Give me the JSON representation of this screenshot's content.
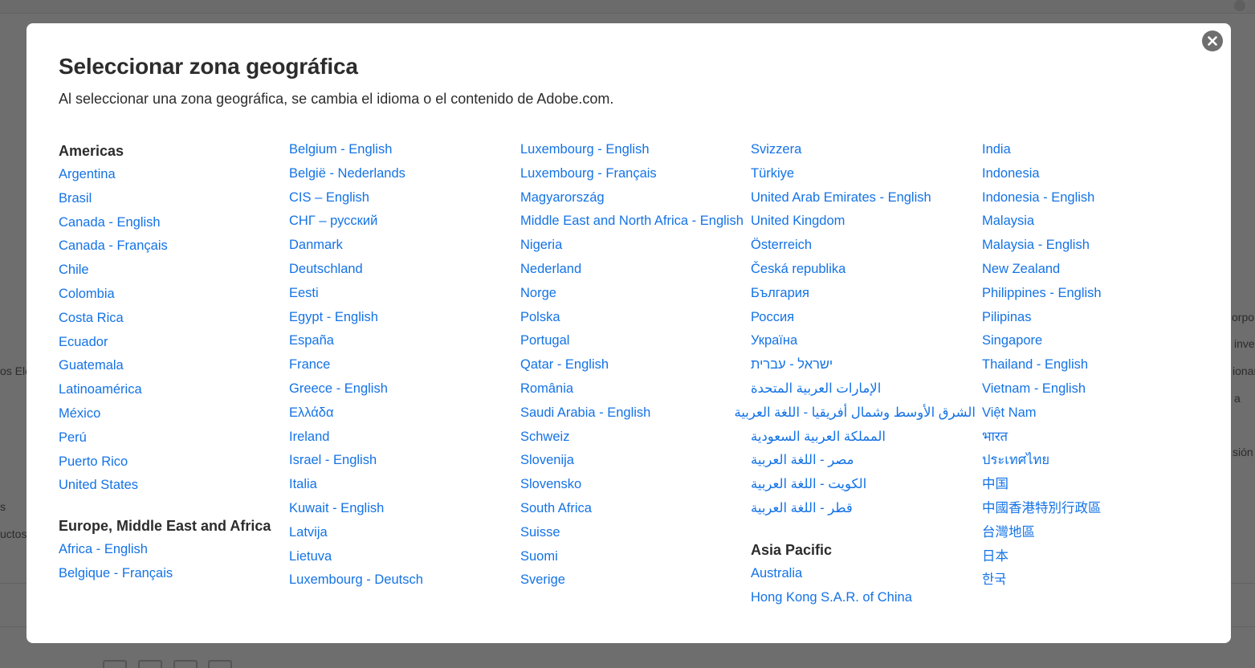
{
  "modal": {
    "title": "Seleccionar zona geográfica",
    "subtitle": "Al seleccionar una zona geográfica, se cambia el idioma o el contenido de Adobe.com.",
    "close_icon": "close-icon"
  },
  "background": {
    "fragments": [
      "os Ele",
      "s",
      "uctos",
      "orpo",
      "inve",
      "ionar",
      "a",
      "sión"
    ]
  },
  "regions": {
    "americas": {
      "heading": "Americas",
      "items": [
        "Argentina",
        "Brasil",
        "Canada - English",
        "Canada - Français",
        "Chile",
        "Colombia",
        "Costa Rica",
        "Ecuador",
        "Guatemala",
        "Latinoamérica",
        "México",
        "Perú",
        "Puerto Rico",
        "United States"
      ]
    },
    "emea": {
      "heading": "Europe, Middle East and Africa",
      "col1": [
        "Africa - English",
        "Belgique - Français"
      ],
      "col2": [
        "Belgium - English",
        "België - Nederlands",
        "CIS – English",
        "СНГ – русский",
        "Danmark",
        "Deutschland",
        "Eesti",
        "Egypt - English",
        "España",
        "France",
        "Greece - English",
        "Ελλάδα",
        "Ireland",
        "Israel - English",
        "Italia",
        "Kuwait - English",
        "Latvija",
        "Lietuva",
        "Luxembourg - Deutsch"
      ],
      "col3": [
        "Luxembourg - English",
        "Luxembourg - Français",
        "Magyarország",
        "Middle East and North Africa - English",
        "Nigeria",
        "Nederland",
        "Norge",
        "Polska",
        "Portugal",
        "Qatar - English",
        "România",
        "Saudi Arabia - English",
        "Schweiz",
        "Slovenija",
        "Slovensko",
        "South Africa",
        "Suisse",
        "Suomi",
        "Sverige"
      ],
      "col4": [
        "Svizzera",
        "Türkiye",
        "United Arab Emirates - English",
        "United Kingdom",
        "Österreich",
        "Česká republika",
        "България",
        "Россия",
        "Україна",
        "ישראל - עברית",
        "الإمارات العربية المتحدة",
        "الشرق الأوسط وشمال أفريقيا - اللغة العربية",
        "المملكة العربية السعودية",
        "مصر - اللغة العربية",
        "الكويت - اللغة العربية",
        "قطر - اللغة العربية"
      ]
    },
    "asia_pacific": {
      "heading": "Asia Pacific",
      "col4": [
        "Australia",
        "Hong Kong S.A.R. of China"
      ],
      "col5": [
        "India",
        "Indonesia",
        "Indonesia - English",
        "Malaysia",
        "Malaysia - English",
        "New Zealand",
        "Philippines - English",
        "Pilipinas",
        "Singapore",
        "Thailand - English",
        "Vietnam - English",
        "Việt Nam",
        "भारत",
        "ประเทศไทย",
        "中国",
        "中國香港特別行政區",
        "台灣地區",
        "日本",
        "한국"
      ]
    }
  },
  "colors": {
    "link": "#1473e6",
    "text": "#2c2c2c",
    "overlay": "#6e6e6e",
    "close_button": "#6e6e6e"
  }
}
